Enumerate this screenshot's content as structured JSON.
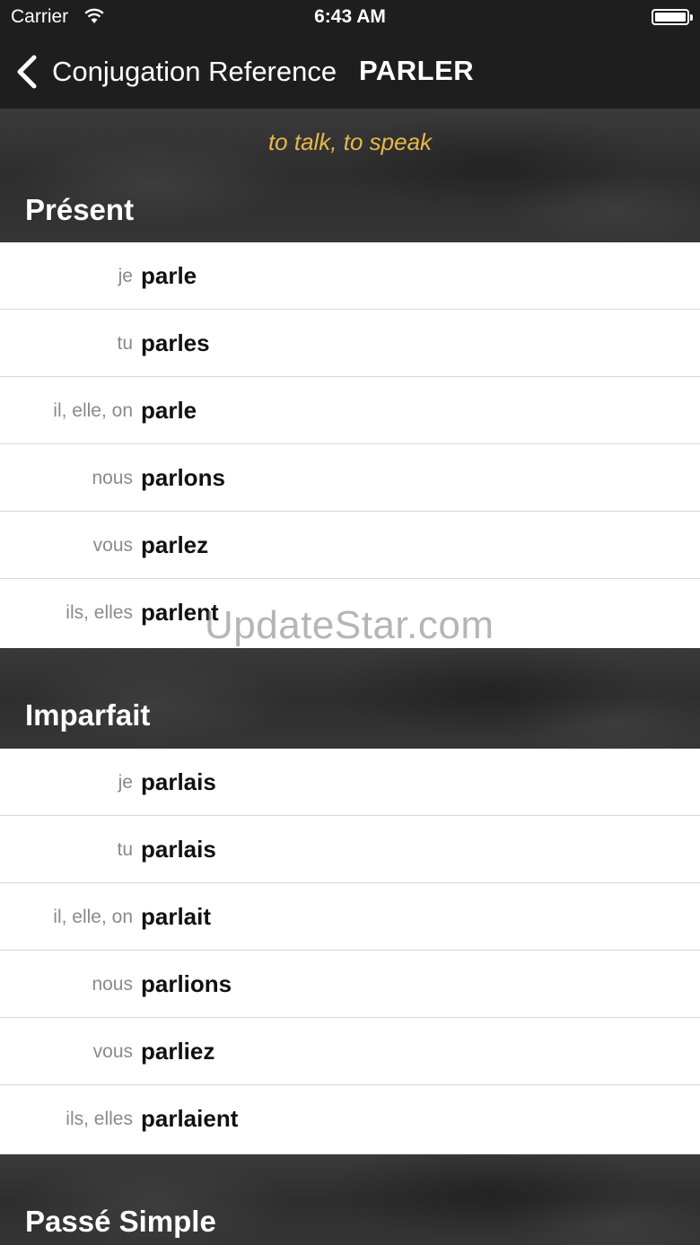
{
  "status_bar": {
    "carrier": "Carrier",
    "time": "6:43 AM"
  },
  "nav": {
    "back_label": "Conjugation Reference",
    "title": "PARLER"
  },
  "translation": "to talk, to speak",
  "sections": [
    {
      "title": "Présent",
      "rows": [
        {
          "pronoun": "je",
          "verb": "parle"
        },
        {
          "pronoun": "tu",
          "verb": "parles"
        },
        {
          "pronoun": "il, elle, on",
          "verb": "parle"
        },
        {
          "pronoun": "nous",
          "verb": "parlons"
        },
        {
          "pronoun": "vous",
          "verb": "parlez"
        },
        {
          "pronoun": "ils, elles",
          "verb": "parlent"
        }
      ]
    },
    {
      "title": "Imparfait",
      "rows": [
        {
          "pronoun": "je",
          "verb": "parlais"
        },
        {
          "pronoun": "tu",
          "verb": "parlais"
        },
        {
          "pronoun": "il, elle, on",
          "verb": "parlait"
        },
        {
          "pronoun": "nous",
          "verb": "parlions"
        },
        {
          "pronoun": "vous",
          "verb": "parliez"
        },
        {
          "pronoun": "ils, elles",
          "verb": "parlaient"
        }
      ]
    },
    {
      "title": "Passé Simple",
      "rows": []
    }
  ],
  "watermark": "UpdateStar.com",
  "colors": {
    "accent": "#e7b84a",
    "bar": "#1e1e1e"
  }
}
